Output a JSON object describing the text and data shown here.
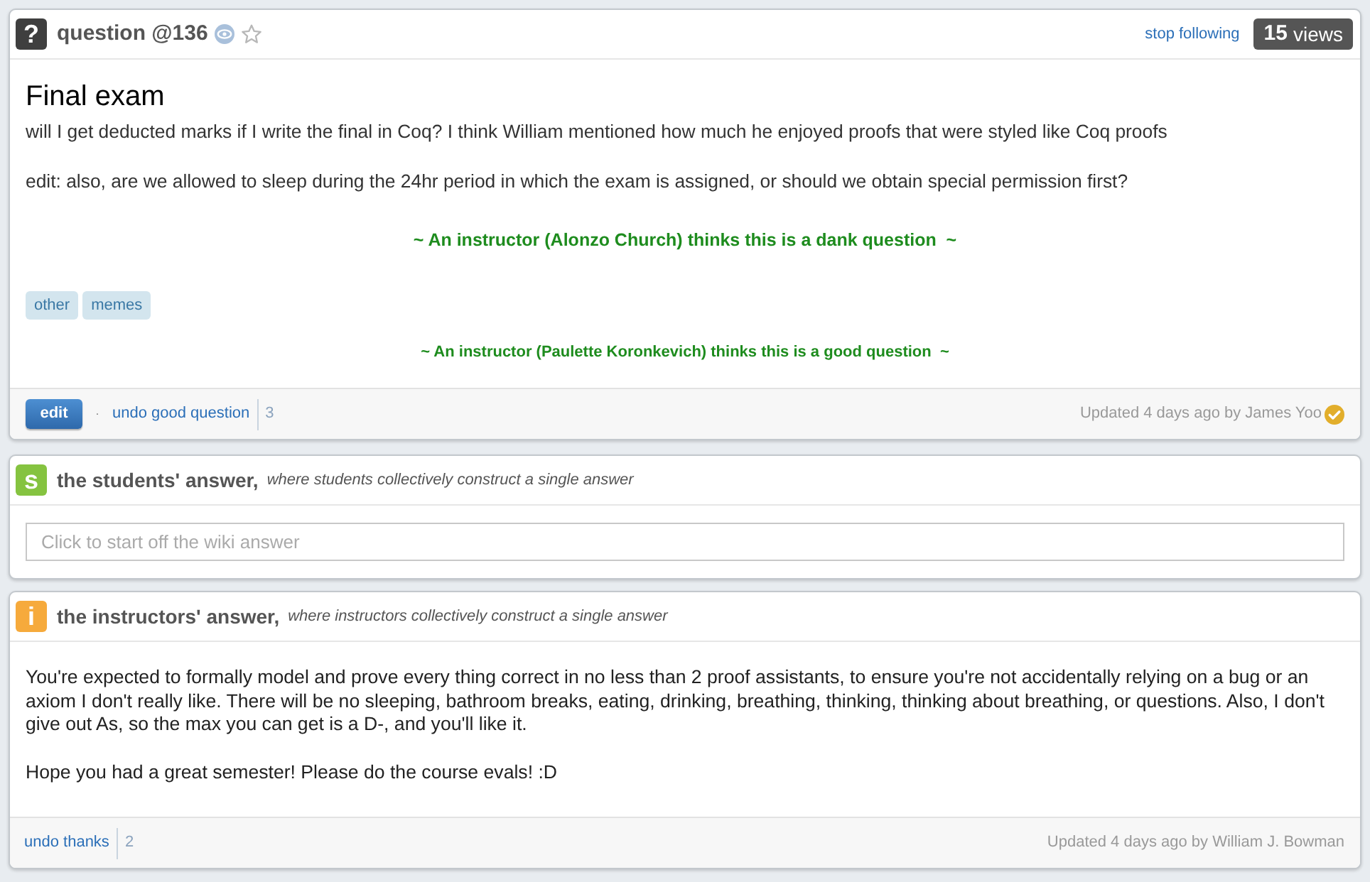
{
  "question": {
    "badge": "?",
    "label": "question @136",
    "starred": false,
    "follow_link": "stop following",
    "views": {
      "count": "15",
      "label": "views"
    },
    "title": "Final exam",
    "paragraphs": [
      "will I get deducted marks if I write the final in Coq? I think William mentioned how much he enjoyed proofs that were styled like Coq proofs",
      "edit: also, are we allowed to sleep during the 24hr period in which the exam is assigned, or should we obtain special permission first?"
    ],
    "endorsements": [
      {
        "kind": "big",
        "text": "~ An instructor (Alonzo Church) thinks this is a dank question  ~"
      },
      {
        "kind": "small",
        "text": "~ An instructor (Paulette Koronkevich) thinks this is a good question  ~"
      }
    ],
    "tags": [
      "other",
      "memes"
    ],
    "footer": {
      "edit_button": "edit",
      "separator": "·",
      "action_link": "undo good question",
      "count": "3",
      "updated": "Updated 4 days ago by James Yoo",
      "author_verified": true
    }
  },
  "students_answer": {
    "badge": "s",
    "title": "the students' answer,",
    "subtitle": "where students collectively construct a single answer",
    "placeholder": "Click to start off the wiki answer"
  },
  "instructors_answer": {
    "badge": "i",
    "title": "the instructors' answer,",
    "subtitle": "where instructors collectively construct a single answer",
    "paragraphs": [
      "You're expected to formally model and prove every thing correct in no less than 2 proof assistants, to ensure you're not accidentally relying on a bug or an axiom I don't really like. There will be no sleeping, bathroom breaks, eating, drinking, breathing, thinking, thinking about breathing, or questions. Also, I don't give out As, so the max you can get is a D-, and you'll like it.",
      "Hope you had a great semester! Please do the course evals! :D"
    ],
    "footer": {
      "action_link": "undo thanks",
      "count": "2",
      "updated": "Updated 4 days ago by William J. Bowman"
    }
  }
}
